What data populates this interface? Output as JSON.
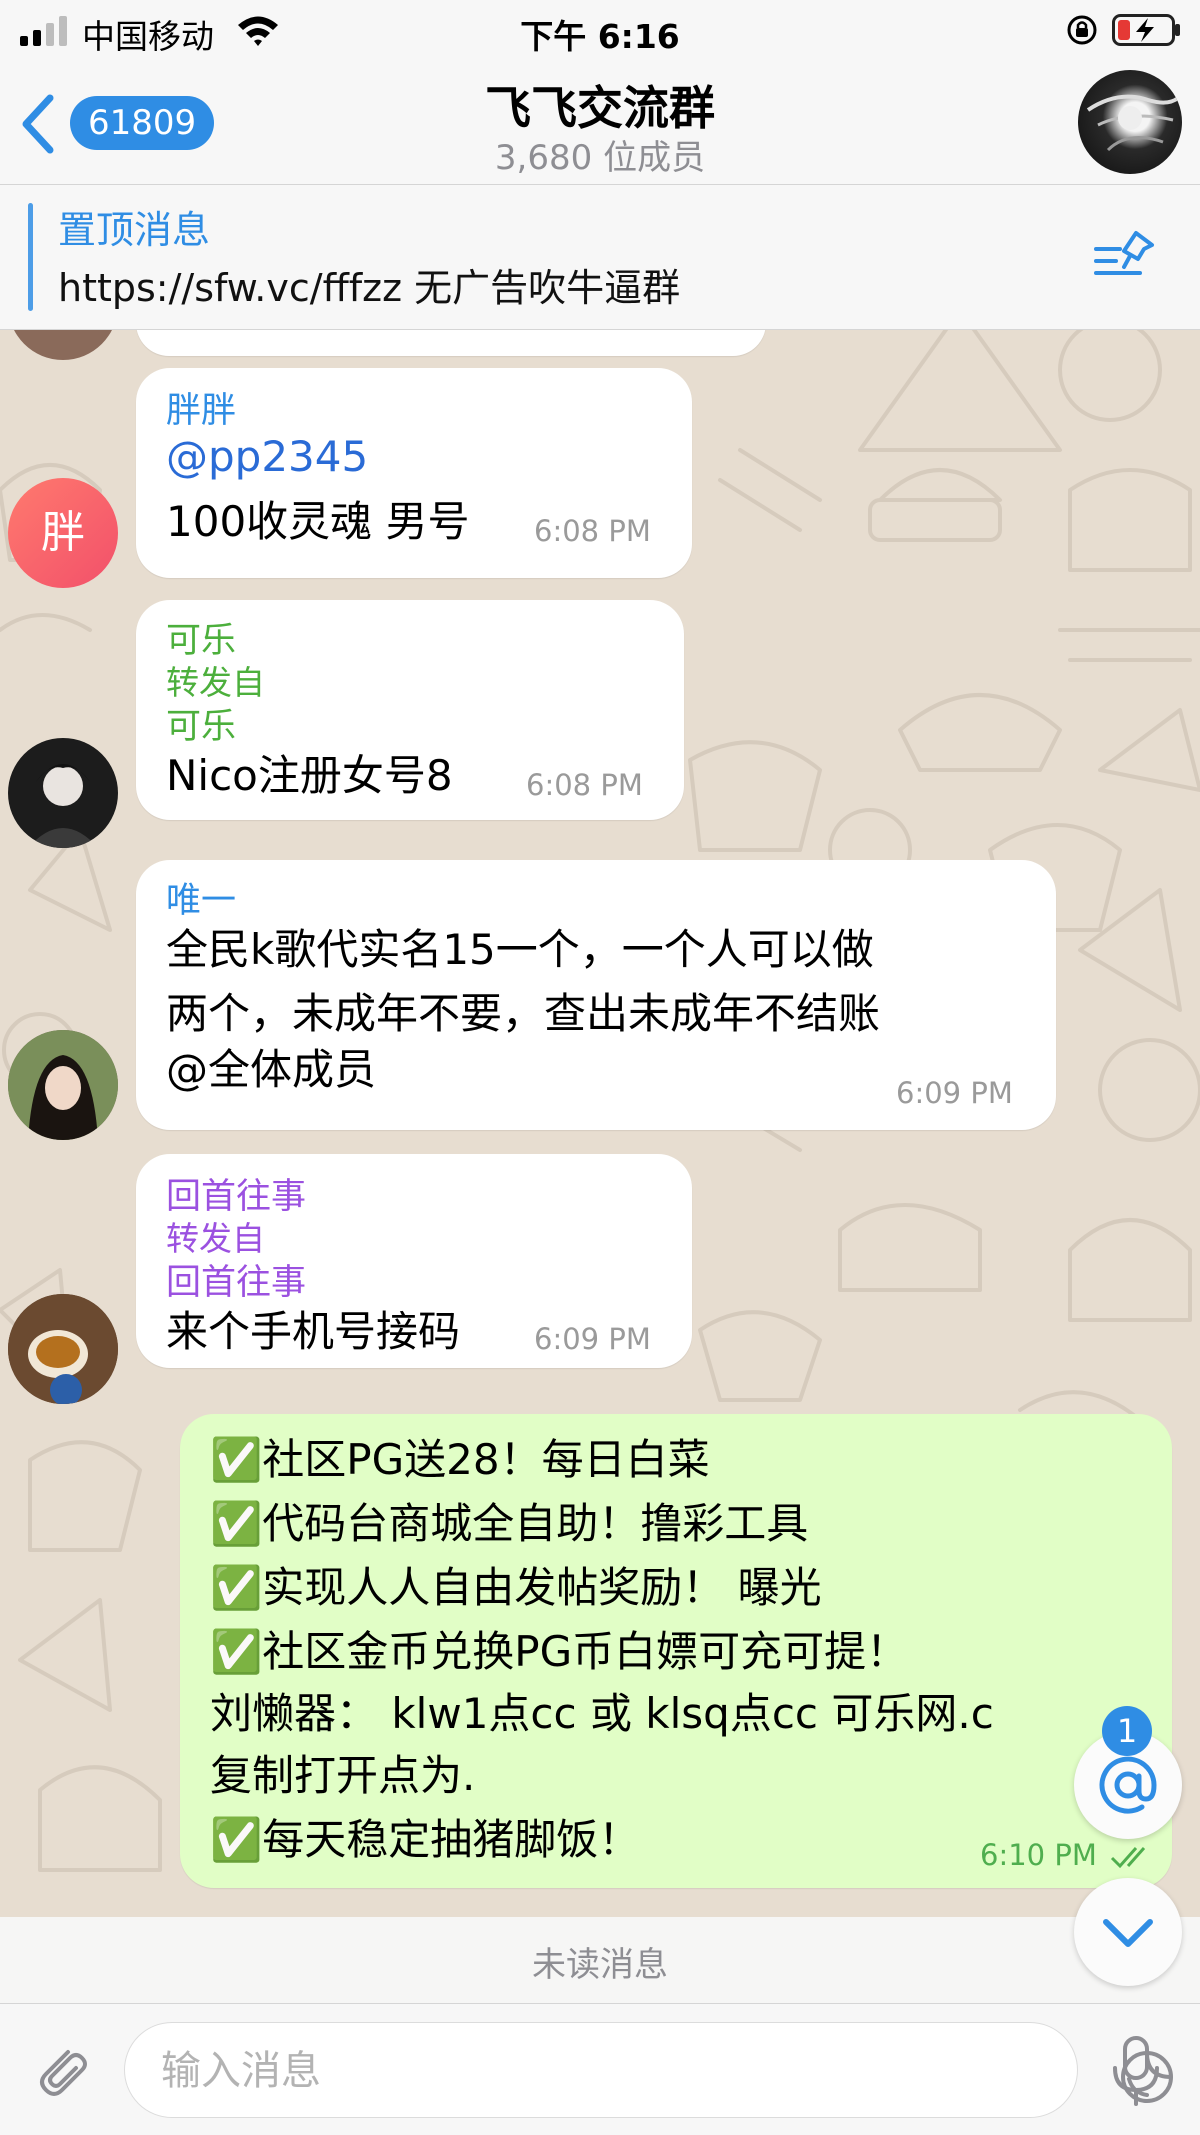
{
  "status_bar": {
    "carrier": "中国移动",
    "time": "下午 6:16"
  },
  "nav": {
    "back_badge": "61809",
    "title": "飞飞交流群",
    "subtitle": "3,680 位成员"
  },
  "pinned": {
    "title": "置顶消息",
    "text": "https://sfw.vc/fffzz 无广告吹牛逼群"
  },
  "colors": {
    "accent": "#2f8de4",
    "own_bubble": "#e1fec6",
    "own_time": "#4fae4e",
    "chat_bg": "#e7ddd0"
  },
  "messages": [
    {
      "sender": "胖胖",
      "avatar_text": "胖",
      "mention": "@pp2345",
      "lines": [
        "100收灵魂 男号"
      ],
      "time": "6:08 PM"
    },
    {
      "sender": "可乐",
      "forwarded_label": "转发自",
      "forwarded_from": "可乐",
      "lines": [
        "Nico注册女号8"
      ],
      "time": "6:08 PM"
    },
    {
      "sender": "唯一",
      "lines": [
        "全民k歌代实名15一个，一个人可以做",
        "两个，未成年不要，查出未成年不结账",
        "@全体成员"
      ],
      "time": "6:09 PM"
    },
    {
      "sender": "回首往事",
      "forwarded_label": "转发自",
      "forwarded_from": "回首往事",
      "lines": [
        "来个手机号接码"
      ],
      "time": "6:09 PM"
    },
    {
      "outgoing": true,
      "check": "✅",
      "lines": [
        "社区PG送28！每日白菜",
        "代码台商城全自助！撸彩工具",
        "实现人人自由发帖奖励！ 曝光",
        "社区金币兑换PG币白嫖可充可提！",
        "刘懒器： klw1点cc 或 klsq点cc 可乐网.c",
        "复制打开点为.",
        "每天稳定抽猪脚饭！"
      ],
      "time": "6:10 PM"
    }
  ],
  "unread_label": "未读消息",
  "mention_count": "1",
  "input": {
    "placeholder": "输入消息"
  },
  "icons": [
    "signal-icon",
    "wifi-icon",
    "orientation-lock-icon",
    "battery-charging-icon",
    "back-chevron-icon",
    "pin-list-icon",
    "at-mention-icon",
    "scroll-down-chevron-icon",
    "paperclip-icon",
    "sticker-icon",
    "microphone-icon",
    "double-check-icon"
  ]
}
